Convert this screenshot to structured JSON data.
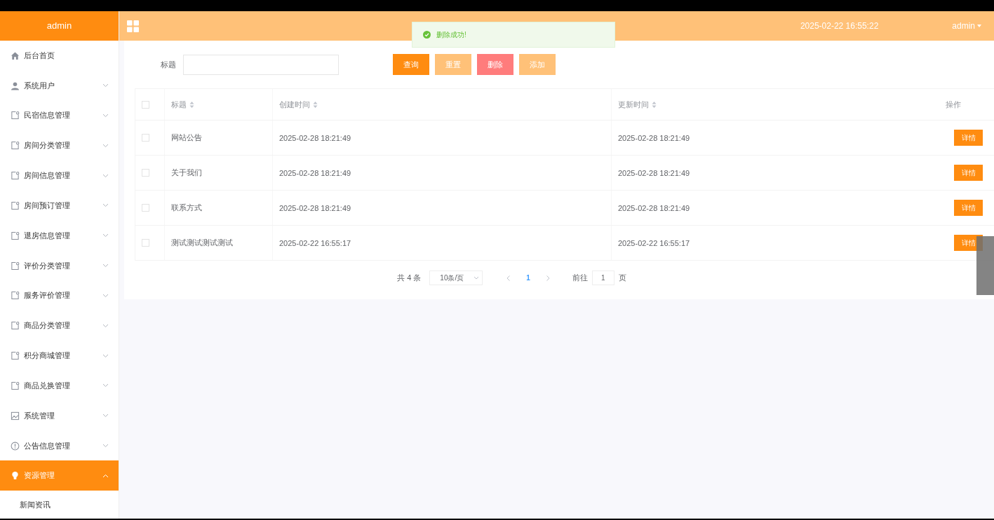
{
  "sidebar": {
    "title": "admin",
    "items": [
      {
        "label": "后台首页",
        "kind": "home",
        "expandable": false,
        "selected": false
      },
      {
        "label": "系统用户",
        "kind": "user",
        "expandable": true,
        "expanded": false,
        "selected": false
      },
      {
        "label": "民宿信息管理",
        "kind": "doc",
        "expandable": true,
        "expanded": false,
        "selected": false
      },
      {
        "label": "房间分类管理",
        "kind": "doc",
        "expandable": true,
        "expanded": false,
        "selected": false
      },
      {
        "label": "房间信息管理",
        "kind": "doc",
        "expandable": true,
        "expanded": false,
        "selected": false
      },
      {
        "label": "房间预订管理",
        "kind": "doc",
        "expandable": true,
        "expanded": false,
        "selected": false
      },
      {
        "label": "退房信息管理",
        "kind": "doc",
        "expandable": true,
        "expanded": false,
        "selected": false
      },
      {
        "label": "评价分类管理",
        "kind": "doc",
        "expandable": true,
        "expanded": false,
        "selected": false
      },
      {
        "label": "服务评价管理",
        "kind": "doc",
        "expandable": true,
        "expanded": false,
        "selected": false
      },
      {
        "label": "商品分类管理",
        "kind": "doc",
        "expandable": true,
        "expanded": false,
        "selected": false
      },
      {
        "label": "积分商城管理",
        "kind": "doc",
        "expandable": true,
        "expanded": false,
        "selected": false
      },
      {
        "label": "商品兑换管理",
        "kind": "doc",
        "expandable": true,
        "expanded": false,
        "selected": false
      },
      {
        "label": "系统管理",
        "kind": "image",
        "expandable": true,
        "expanded": false,
        "selected": false
      },
      {
        "label": "公告信息管理",
        "kind": "info",
        "expandable": true,
        "expanded": false,
        "selected": false
      },
      {
        "label": "资源管理",
        "kind": "bulb",
        "expandable": true,
        "expanded": true,
        "selected": true,
        "children": [
          {
            "label": "新闻资讯",
            "selected": false
          }
        ]
      }
    ]
  },
  "header": {
    "datetime": "2025-02-22 16:55:22",
    "user": "admin"
  },
  "toast": {
    "message": "删除成功!"
  },
  "search": {
    "label": "标题",
    "buttons": [
      {
        "label": "查询",
        "kind": "primary"
      },
      {
        "label": "重置",
        "kind": "light"
      },
      {
        "label": "删除",
        "kind": "danger"
      },
      {
        "label": "添加",
        "kind": "light"
      }
    ]
  },
  "table": {
    "all_checked": false,
    "columns": [
      "标题",
      "创建时间",
      "更新时间",
      "操作"
    ],
    "rows": [
      {
        "checked": false,
        "title": "网站公告",
        "created": "2025-02-28 18:21:49",
        "updated": "2025-02-28 18:21:49",
        "action": "详情"
      },
      {
        "checked": false,
        "title": "关于我们",
        "created": "2025-02-28 18:21:49",
        "updated": "2025-02-28 18:21:49",
        "action": "详情"
      },
      {
        "checked": false,
        "title": "联系方式",
        "created": "2025-02-28 18:21:49",
        "updated": "2025-02-28 18:21:49",
        "action": "详情"
      },
      {
        "checked": false,
        "title": "测试测试测试测试",
        "created": "2025-02-22 16:55:17",
        "updated": "2025-02-22 16:55:17",
        "action": "详情"
      }
    ]
  },
  "pagination": {
    "total": "共 4 条",
    "page_size": "10条/页",
    "pages": [
      {
        "label": "1",
        "selected": true
      }
    ],
    "goto_label": "前往",
    "goto_value": "1",
    "goto_suffix": "页"
  }
}
